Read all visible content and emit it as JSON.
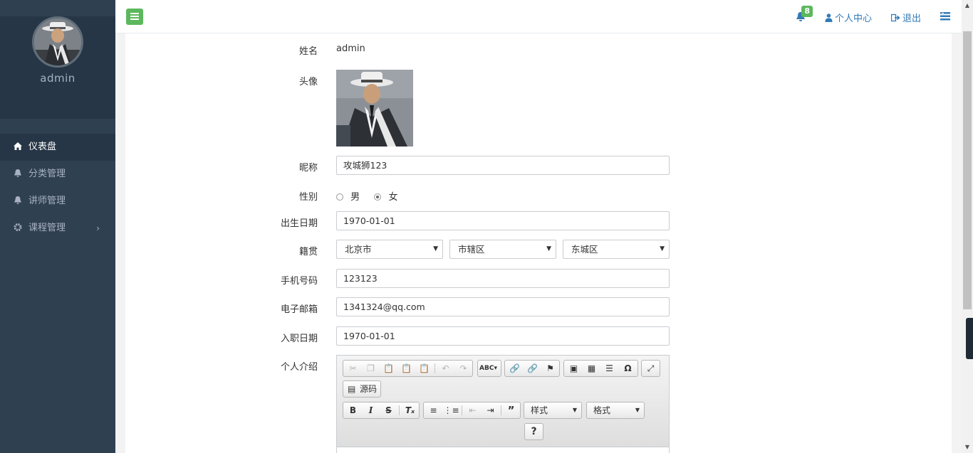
{
  "sidebar": {
    "username": "admin",
    "items": [
      {
        "label": "仪表盘",
        "icon": "home-icon"
      },
      {
        "label": "分类管理",
        "icon": "bell-icon"
      },
      {
        "label": "讲师管理",
        "icon": "bell-icon"
      },
      {
        "label": "课程管理",
        "icon": "gear-icon"
      }
    ]
  },
  "topbar": {
    "notification_count": "8",
    "profile_label": "个人中心",
    "logout_label": "退出"
  },
  "form": {
    "name_label": "姓名",
    "name_value": "admin",
    "avatar_label": "头像",
    "nickname_label": "昵称",
    "nickname_value": "攻城狮123",
    "gender_label": "性别",
    "gender_male": "男",
    "gender_female": "女",
    "gender_selected": "女",
    "birthday_label": "出生日期",
    "birthday_value": "1970-01-01",
    "hometown_label": "籍贯",
    "province": "北京市",
    "city": "市辖区",
    "district": "东城区",
    "phone_label": "手机号码",
    "phone_value": "123123",
    "email_label": "电子邮箱",
    "email_value": "1341324@qq.com",
    "hire_label": "入职日期",
    "hire_value": "1970-01-01",
    "intro_label": "个人介绍"
  },
  "editor": {
    "source_label": "源码",
    "style_label": "样式",
    "format_label": "格式",
    "help_label": "?"
  },
  "colors": {
    "sidebar_bg": "#2f4050",
    "accent_green": "#5cb85c",
    "link_blue": "#337ab7"
  }
}
